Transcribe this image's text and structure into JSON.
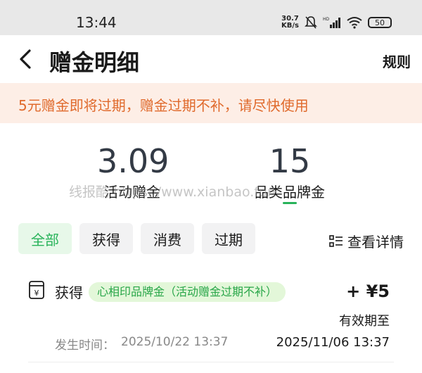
{
  "status_bar": {
    "time": "13:44",
    "net_speed_value": "30.7",
    "net_speed_unit": "KB/s",
    "battery": "50"
  },
  "header": {
    "title": "赠金明细",
    "rules_label": "规则"
  },
  "notice": {
    "text": "5元赠金即将过期，赠金过期不补，请尽快使用"
  },
  "stats": {
    "activity_value": "3.09",
    "activity_label": "活动赠金",
    "category_value": "15",
    "category_label": "品类品牌金"
  },
  "watermark": "线报酷 https://www.xianbao.fun",
  "filters": {
    "tabs": [
      "全部",
      "获得",
      "消费",
      "过期"
    ],
    "active_index": 0,
    "view_details_label": "查看详情"
  },
  "records": [
    {
      "type": "获得",
      "tag": "心相印品牌金（活动赠金过期不补）",
      "amount": "+ ¥5",
      "valid_label": "有效期至",
      "time_label": "发生时间：",
      "time": "2025/10/22 13:37",
      "expiry": "2025/11/06 13:37"
    }
  ],
  "colors": {
    "accent": "#28b35a",
    "notice_bg": "#fdeee6",
    "notice_text": "#e06a2c"
  }
}
